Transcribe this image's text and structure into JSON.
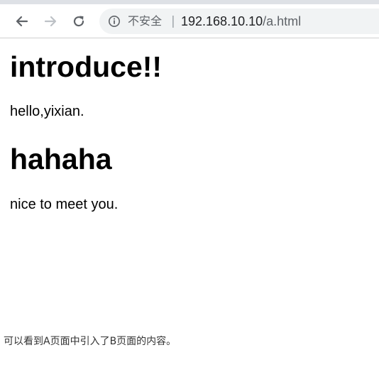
{
  "browser": {
    "security_label": "不安全",
    "separator": "|",
    "url_host": "192.168.10.10",
    "url_path": "/a.html",
    "icons": {
      "back": "back-arrow-icon",
      "forward": "forward-arrow-icon",
      "reload": "reload-icon",
      "info": "info-icon"
    },
    "colors": {
      "toolbar_bg": "#ffffff",
      "omnibox_bg": "#f1f3f4",
      "icon_active": "#5f6368",
      "icon_disabled": "#bdc1c6"
    }
  },
  "page": {
    "heading1": "introduce!!",
    "paragraph1": "hello,yixian.",
    "heading2": "hahaha",
    "paragraph2": "nice to meet you."
  },
  "caption": "可以看到A页面中引入了B页面的内容。"
}
